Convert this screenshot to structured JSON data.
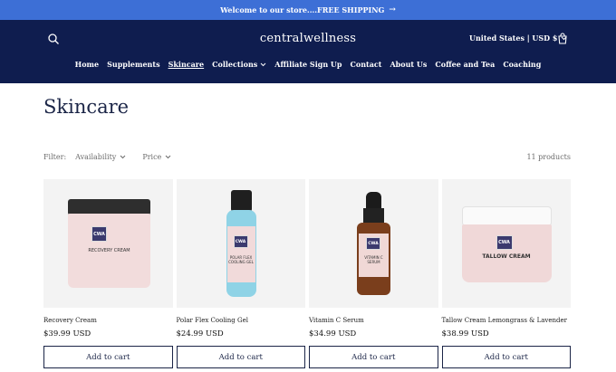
{
  "announcement": {
    "text": "Welcome to our store....FREE SHIPPING"
  },
  "header": {
    "logo": "centralwellness",
    "country": "United States | USD $",
    "nav": [
      {
        "label": "Home"
      },
      {
        "label": "Supplements"
      },
      {
        "label": "Skincare",
        "active": true
      },
      {
        "label": "Collections",
        "dropdown": true
      },
      {
        "label": "Affiliate Sign Up"
      },
      {
        "label": "Contact"
      },
      {
        "label": "About Us"
      },
      {
        "label": "Coffee and Tea"
      },
      {
        "label": "Coaching"
      }
    ]
  },
  "page": {
    "title": "Skincare"
  },
  "filters": {
    "label": "Filter:",
    "availability": "Availability",
    "price": "Price",
    "count": "11 products"
  },
  "products": [
    {
      "name": "Recovery Cream",
      "price": "$39.99 USD",
      "button": "Add to cart",
      "label": {
        "brand": "CWA",
        "title": "RECOVERY CREAM"
      }
    },
    {
      "name": "Polar Flex Cooling Gel",
      "price": "$24.99 USD",
      "button": "Add to cart",
      "label": {
        "brand": "CWA",
        "title": "POLAR FLEX COOLING GEL"
      }
    },
    {
      "name": "Vitamin C Serum",
      "price": "$34.99 USD",
      "button": "Add to cart",
      "label": {
        "brand": "CWA",
        "title": "VITAMIN C SERUM"
      }
    },
    {
      "name": "Tallow Cream Lemongrass & Lavender",
      "price": "$38.99 USD",
      "button": "Add to cart",
      "label": {
        "brand": "CWA",
        "title": "TALLOW CREAM"
      }
    }
  ],
  "colors": {
    "announcement": "#3d6fd6",
    "header": "#0f1d4f",
    "title": "#1b2547"
  }
}
